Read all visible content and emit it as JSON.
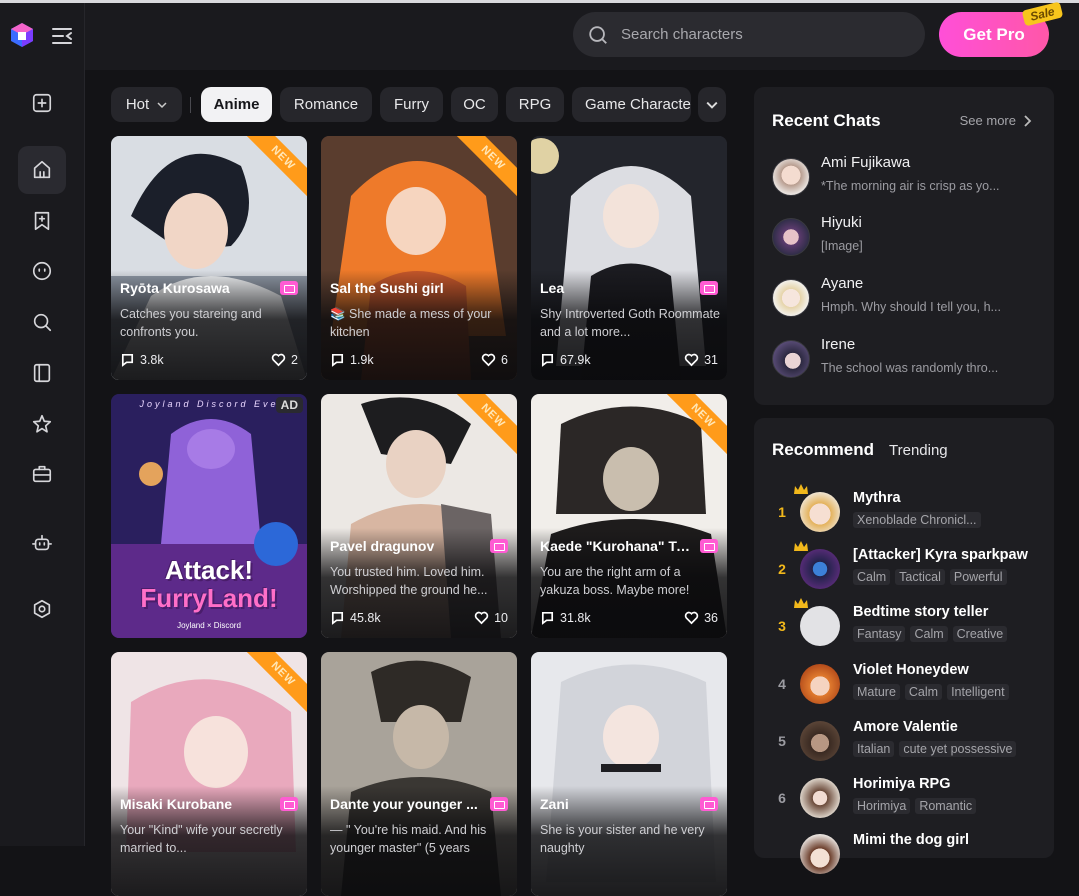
{
  "header": {
    "search_placeholder": "Search characters",
    "get_pro": "Get Pro",
    "sale": "Sale"
  },
  "sidebar": {
    "icons": [
      "add-icon",
      "home-icon",
      "bookmark-add-icon",
      "chat-face-icon",
      "search-icon",
      "book-icon",
      "star-badge-icon",
      "briefcase-icon",
      "robot-icon",
      "settings-hex-icon"
    ]
  },
  "filters": {
    "sort": "Hot",
    "chips": [
      "Anime",
      "Romance",
      "Furry",
      "OC",
      "RPG",
      "Game Characte"
    ]
  },
  "cards": [
    {
      "name": "Ryōta Kurosawa",
      "desc": "Catches you stareing and confronts you.",
      "chats": "3.8k",
      "likes": "2",
      "badge": "NEW"
    },
    {
      "name": "Sal the Sushi girl",
      "desc": "📚 She made a mess of your kitchen",
      "chats": "1.9k",
      "likes": "6",
      "badge": "NEW"
    },
    {
      "name": "Lea",
      "desc": "Shy Introverted Goth Roommate and a lot more...",
      "chats": "67.9k",
      "likes": "31",
      "badge": ""
    },
    {
      "name": "",
      "desc": "",
      "chats": "",
      "likes": "",
      "badge": "AD",
      "ad_top": "Joyland Discord Eve",
      "ad_line1": "Attack!",
      "ad_line2": "FurryLand!",
      "ad_foot": "Joyland × Discord"
    },
    {
      "name": "Pavel dragunov",
      "desc": "You trusted him. Loved him. Worshipped the ground he...",
      "chats": "45.8k",
      "likes": "10",
      "badge": "NEW"
    },
    {
      "name": "Kaede \"Kurohana\" Ta...",
      "desc": "You are the right arm of a yakuza boss. Maybe more!",
      "chats": "31.8k",
      "likes": "36",
      "badge": "NEW"
    },
    {
      "name": "Misaki Kurobane",
      "desc": "Your \"Kind\" wife your secretly married to...",
      "chats": "",
      "likes": "",
      "badge": "NEW"
    },
    {
      "name": "Dante your younger ...",
      "desc": "— \" You're his maid. And his younger master\" (5 years",
      "chats": "",
      "likes": "",
      "badge": ""
    },
    {
      "name": "Zani",
      "desc": "She is your sister and he very naughty",
      "chats": "",
      "likes": "",
      "badge": ""
    }
  ],
  "recent": {
    "title": "Recent Chats",
    "see_more": "See more",
    "items": [
      {
        "name": "Ami Fujikawa",
        "msg": "*The morning air is crisp as yo..."
      },
      {
        "name": "Hiyuki",
        "msg": "[Image]"
      },
      {
        "name": "Ayane",
        "msg": "Hmph. Why should I tell you, h..."
      },
      {
        "name": "Irene",
        "msg": "The school was randomly thro..."
      }
    ]
  },
  "recommend": {
    "title": "Recommend",
    "trending": "Trending",
    "items": [
      {
        "rank": "1",
        "name": "Mythra",
        "tags": [
          "Xenoblade Chronicl..."
        ]
      },
      {
        "rank": "2",
        "name": "[Attacker] Kyra sparkpaw",
        "tags": [
          "Calm",
          "Tactical",
          "Powerful"
        ]
      },
      {
        "rank": "3",
        "name": "Bedtime story teller",
        "tags": [
          "Fantasy",
          "Calm",
          "Creative"
        ]
      },
      {
        "rank": "4",
        "name": "Violet Honeydew",
        "tags": [
          "Mature",
          "Calm",
          "Intelligent"
        ]
      },
      {
        "rank": "5",
        "name": "Amore Valentie",
        "tags": [
          "Italian",
          "cute yet possessive"
        ]
      },
      {
        "rank": "6",
        "name": "Horimiya RPG",
        "tags": [
          "Horimiya",
          "Romantic"
        ]
      },
      {
        "rank": "",
        "name": "Mimi the dog girl",
        "tags": []
      }
    ]
  },
  "colors": {
    "accent": "#ff4fd8",
    "new_badge": "#ff9b1a",
    "rank_gold": "#f2b81b"
  }
}
